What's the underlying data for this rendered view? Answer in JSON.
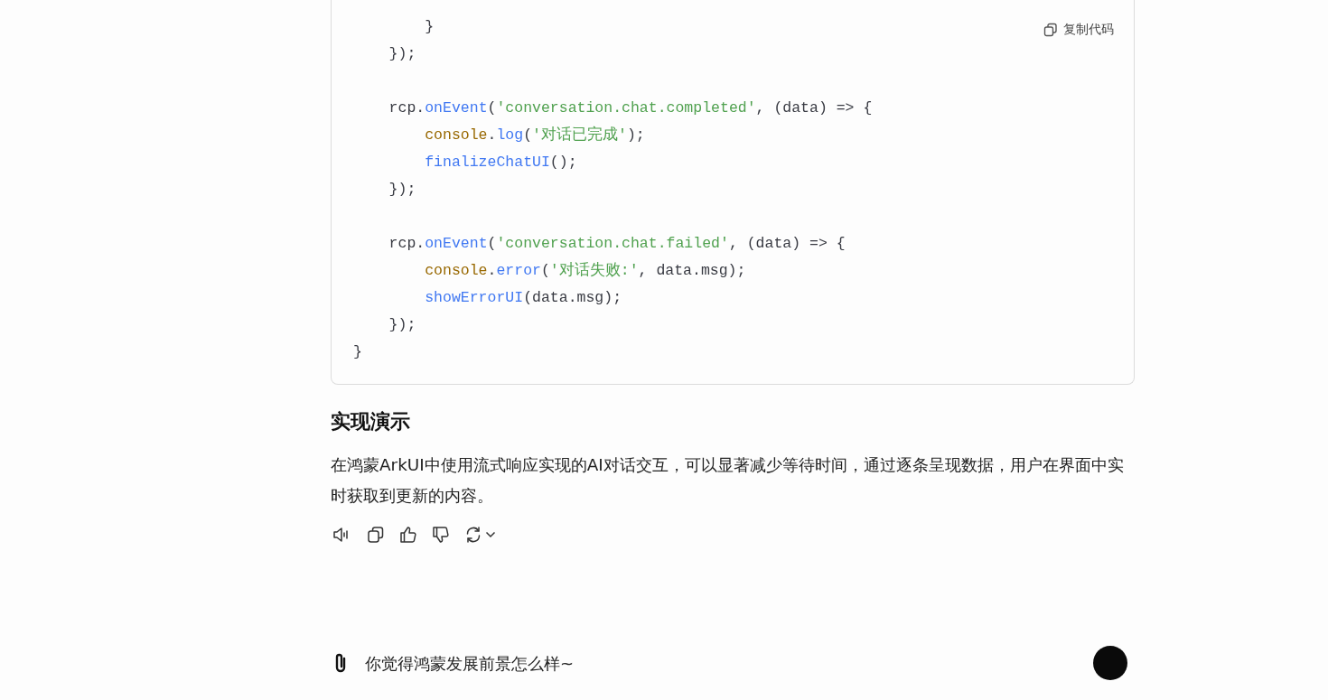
{
  "code_block": {
    "copy_label": "复制代码",
    "lines": [
      {
        "kind": "code",
        "tokens": [
          {
            "kind": "plain",
            "text": "        }"
          }
        ]
      },
      {
        "kind": "code",
        "tokens": [
          {
            "kind": "plain",
            "text": "    });"
          }
        ]
      },
      {
        "kind": "blank"
      },
      {
        "kind": "code",
        "tokens": [
          {
            "kind": "plain",
            "text": "    rcp."
          },
          {
            "kind": "fn",
            "text": "onEvent"
          },
          {
            "kind": "plain",
            "text": "("
          },
          {
            "kind": "str",
            "text": "'conversation.chat.completed'"
          },
          {
            "kind": "plain",
            "text": ", (data) => {"
          }
        ]
      },
      {
        "kind": "code",
        "tokens": [
          {
            "kind": "obj",
            "text": "        console"
          },
          {
            "kind": "plain",
            "text": "."
          },
          {
            "kind": "fn",
            "text": "log"
          },
          {
            "kind": "plain",
            "text": "("
          },
          {
            "kind": "str",
            "text": "'对话已完成'"
          },
          {
            "kind": "plain",
            "text": ");"
          }
        ]
      },
      {
        "kind": "code",
        "tokens": [
          {
            "kind": "fn",
            "text": "        finalizeChatUI"
          },
          {
            "kind": "plain",
            "text": "();"
          }
        ]
      },
      {
        "kind": "code",
        "tokens": [
          {
            "kind": "plain",
            "text": "    });"
          }
        ]
      },
      {
        "kind": "blank"
      },
      {
        "kind": "code",
        "tokens": [
          {
            "kind": "plain",
            "text": "    rcp."
          },
          {
            "kind": "fn",
            "text": "onEvent"
          },
          {
            "kind": "plain",
            "text": "("
          },
          {
            "kind": "str",
            "text": "'conversation.chat.failed'"
          },
          {
            "kind": "plain",
            "text": ", (data) => {"
          }
        ]
      },
      {
        "kind": "code",
        "tokens": [
          {
            "kind": "obj",
            "text": "        console"
          },
          {
            "kind": "plain",
            "text": "."
          },
          {
            "kind": "fn",
            "text": "error"
          },
          {
            "kind": "plain",
            "text": "("
          },
          {
            "kind": "str",
            "text": "'对话失败:'"
          },
          {
            "kind": "plain",
            "text": ", data.msg);"
          }
        ]
      },
      {
        "kind": "code",
        "tokens": [
          {
            "kind": "fn",
            "text": "        showErrorUI"
          },
          {
            "kind": "plain",
            "text": "(data.msg);"
          }
        ]
      },
      {
        "kind": "code",
        "tokens": [
          {
            "kind": "plain",
            "text": "    });"
          }
        ]
      },
      {
        "kind": "code",
        "tokens": [
          {
            "kind": "plain",
            "text": "}"
          }
        ]
      }
    ]
  },
  "heading": "实现演示",
  "paragraph": "在鸿蒙ArkUI中使用流式响应实现的AI对话交互，可以显著减少等待时间，通过逐条呈现数据，用户在界面中实时获取到更新的内容。",
  "composer": {
    "placeholder": "你觉得鸿蒙发展前景怎么样~"
  }
}
